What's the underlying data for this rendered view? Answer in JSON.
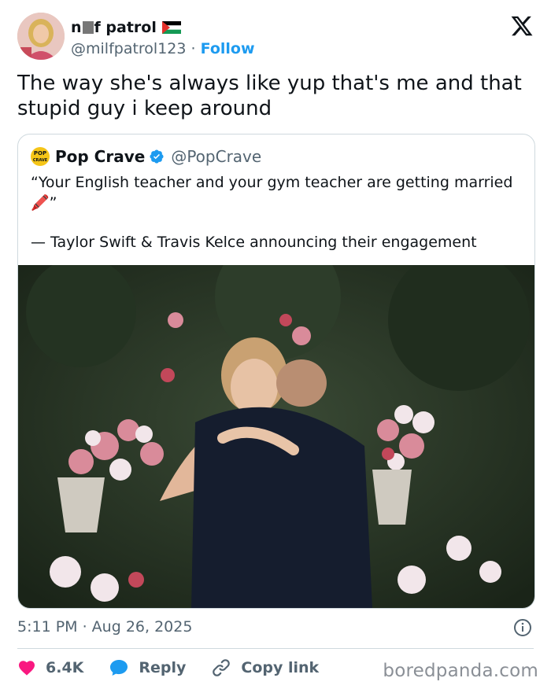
{
  "author": {
    "name_start": "n",
    "name_end": "f patrol",
    "handle": "@milfpatrol123",
    "separator": "·",
    "follow_label": "Follow"
  },
  "tweet": {
    "text": "The way she's always like yup that's me and that stupid guy i keep around"
  },
  "quoted": {
    "name": "Pop Crave",
    "handle": "@PopCrave",
    "logo_text_1": "POP",
    "logo_text_2": "CRAVE",
    "quote_text": "“Your English teacher and your gym teacher are getting married 🖍️”",
    "attribution": "— Taylor Swift & Travis Kelce announcing their engagement"
  },
  "meta": {
    "timestamp": "5:11 PM · Aug 26, 2025"
  },
  "actions": {
    "likes": "6.4K",
    "reply_label": "Reply",
    "copy_label": "Copy link"
  },
  "watermark": "boredpanda.com",
  "colors": {
    "accent": "#1d9bf0",
    "like": "#f91880",
    "muted": "#536471"
  },
  "icons": [
    "x-logo-icon",
    "verified-badge-icon",
    "info-icon",
    "heart-icon",
    "reply-icon",
    "link-icon"
  ]
}
